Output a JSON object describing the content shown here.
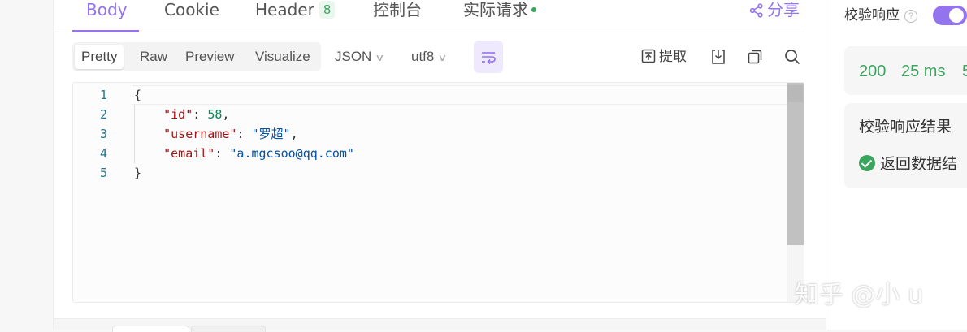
{
  "tabs": {
    "body": "Body",
    "cookie": "Cookie",
    "header": "Header",
    "header_count": "8",
    "console": "控制台",
    "actual_request": "实际请求",
    "share": "分享"
  },
  "toolbar": {
    "views": [
      "Pretty",
      "Raw",
      "Preview",
      "Visualize"
    ],
    "active_view": "Pretty",
    "format": "JSON",
    "encoding": "utf8",
    "extract": "提取"
  },
  "editor": {
    "line_numbers": [
      "1",
      "2",
      "3",
      "4",
      "5"
    ],
    "open_brace": "{",
    "close_brace": "}",
    "id_key": "\"id\"",
    "id_value": "58",
    "username_key": "\"username\"",
    "username_value": "\"罗超\"",
    "email_key": "\"email\"",
    "email_value": "\"a.mgcsoo@qq.com\""
  },
  "right_panel": {
    "verify_label": "校验响应",
    "verify_enabled": true,
    "status_code": "200",
    "time": "25 ms",
    "size": "5",
    "result_title": "校验响应结果",
    "result_item": "返回数据结"
  },
  "watermark": "知乎 @小 u",
  "colors": {
    "accent": "#9373ee",
    "success": "#3aa55d"
  }
}
